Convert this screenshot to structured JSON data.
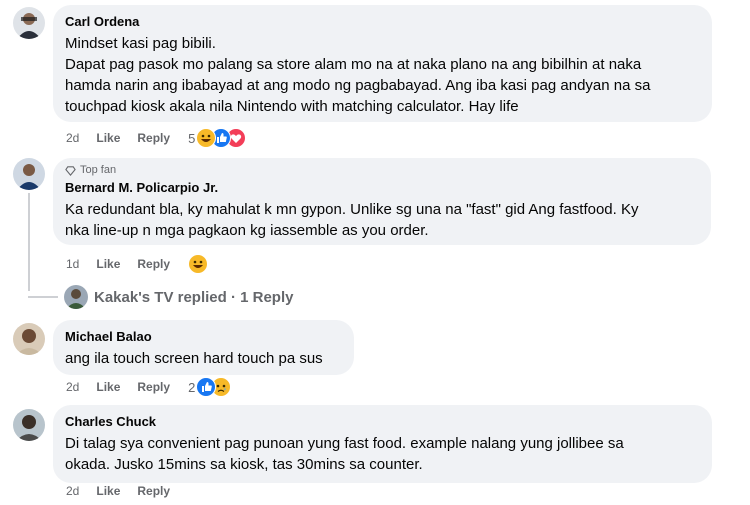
{
  "comments": [
    {
      "author": "Carl Ordena",
      "line1": "Mindset kasi pag bibili.",
      "line2": "Dapat pag pasok mo palang sa store alam mo na at naka plano na ang bibilhin at naka\nhamda narin ang ibabayad at ang modo ng pagbabayad. Ang iba kasi pag andyan na sa\ntouchpad kiosk akala nila Nintendo with matching calculator. Hay life",
      "time": "2d",
      "like": "Like",
      "reply": "Reply",
      "reaction_count": "5",
      "reactions": [
        "haha-icon",
        "like-icon",
        "love-icon"
      ]
    },
    {
      "badge": "Top fan",
      "author": "Bernard M. Policarpio Jr.",
      "text": "Ka redundant bla, ky mahulat k mn gypon. Unlike sg una na \"fast\" gid Ang fastfood. Ky\nnka line-up n mga pagkaon kg iassemble as you order.",
      "time": "1d",
      "like": "Like",
      "reply": "Reply",
      "reactions": [
        "haha-icon"
      ]
    },
    {
      "author": "Michael Balao",
      "text": "ang ila touch screen hard touch pa sus",
      "time": "2d",
      "like": "Like",
      "reply": "Reply",
      "reaction_count": "2",
      "reactions": [
        "like-icon",
        "sad-icon"
      ]
    },
    {
      "author": "Charles Chuck",
      "text": "Di talag sya convenient pag punoan yung fast food. example nalang yung jollibee sa\nokada. Jusko 15mins sa kiosk, tas 30mins sa counter.",
      "time": "2d",
      "like": "Like",
      "reply": "Reply"
    }
  ],
  "replies_link": "Kakak's TV replied · 1 Reply",
  "colors": {
    "bubble": "#f0f2f5",
    "muted": "#65676b",
    "like_blue": "#1877f2",
    "love_red": "#f33e58",
    "haha_yellow": "#f7b928"
  }
}
